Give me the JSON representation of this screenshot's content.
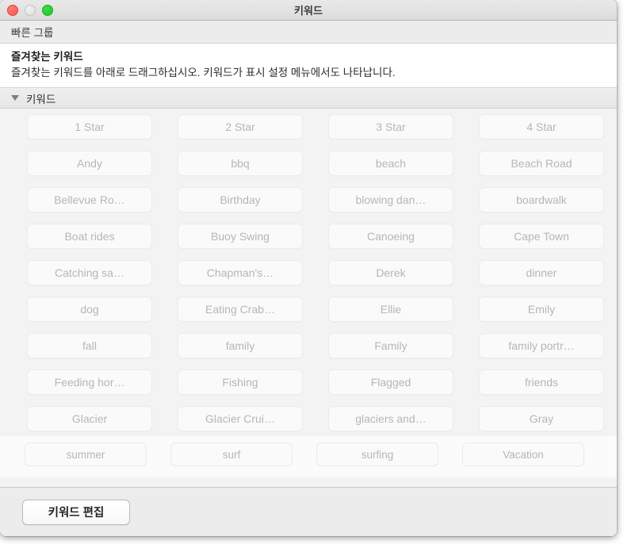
{
  "window": {
    "title": "키워드",
    "traffic_lights": {
      "close": "close-button",
      "minimize": "minimize-button",
      "zoom": "zoom-button"
    }
  },
  "toolbar": {
    "quick_group_label": "빠른 그룹"
  },
  "favorites": {
    "title": "즐겨찾는 키워드",
    "description": "즐겨찾는 키워드를 아래로 드래그하십시오. 키워드가 표시 설정 메뉴에서도 나타납니다."
  },
  "section": {
    "title": "키워드",
    "disclosure_icon": "triangle-down-icon",
    "expanded": true
  },
  "keywords": {
    "columns": 4,
    "rows": [
      [
        "1 Star",
        "2 Star",
        "3 Star",
        "4 Star"
      ],
      [
        "Andy",
        "bbq",
        "beach",
        "Beach Road"
      ],
      [
        "Bellevue Ro…",
        "Birthday",
        "blowing dan…",
        "boardwalk"
      ],
      [
        "Boat rides",
        "Buoy Swing",
        "Canoeing",
        "Cape Town"
      ],
      [
        "Catching sa…",
        "Chapman's…",
        "Derek",
        "dinner"
      ],
      [
        "dog",
        "Eating Crab…",
        "Ellie",
        "Emily"
      ],
      [
        "fall",
        "family",
        "Family",
        "family portr…"
      ],
      [
        "Feeding hor…",
        "Fishing",
        "Flagged",
        "friends"
      ],
      [
        "Glacier",
        "Glacier Crui…",
        "glaciers and…",
        "Gray"
      ],
      [
        "summer",
        "surf",
        "surfing",
        "Vacation"
      ]
    ]
  },
  "footer": {
    "edit_keywords_label": "키워드 편집"
  },
  "colors": {
    "window_chrome": "#ececec",
    "keyword_area_background": "#f3f3f3",
    "keyword_button_background": "#fafafa",
    "keyword_button_text": "#b6b6b6",
    "close_light": "#f9564f",
    "minimize_light": "#dedede",
    "zoom_light": "#1bc520"
  }
}
